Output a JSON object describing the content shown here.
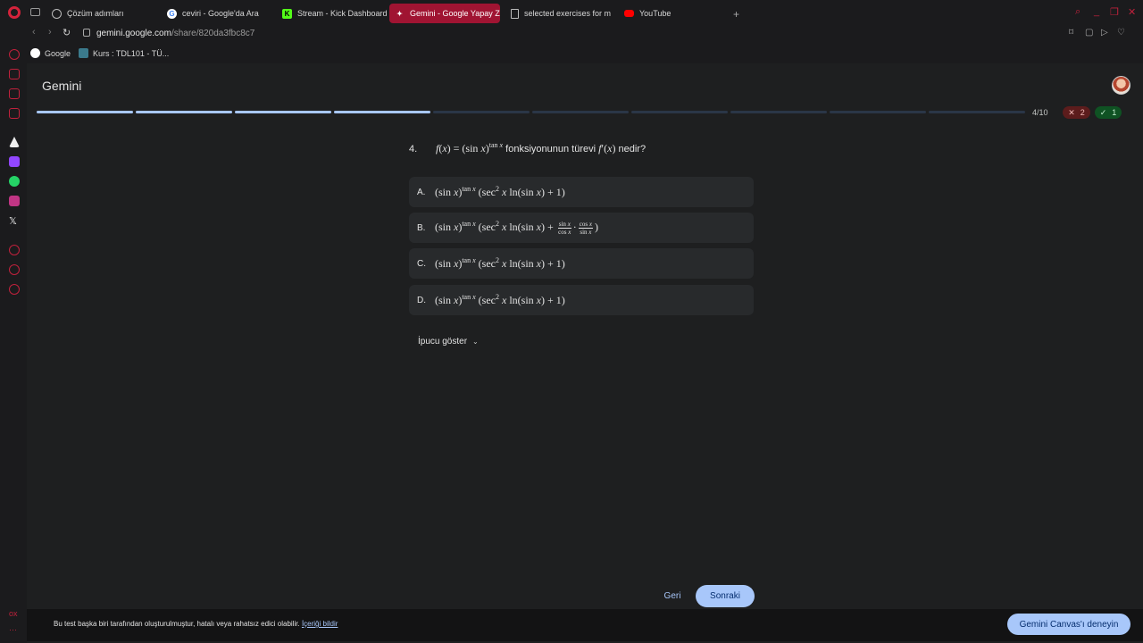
{
  "browser": {
    "tabs": [
      {
        "label": "Çözüm adımları",
        "active": false
      },
      {
        "label": "ceviri - Google'da Ara",
        "active": false
      },
      {
        "label": "Stream - Kick Dashboard",
        "active": false
      },
      {
        "label": "Gemini - Google Yapay Z",
        "active": true
      },
      {
        "label": "selected exercises for m",
        "active": false
      },
      {
        "label": "YouTube",
        "active": false
      }
    ],
    "url_host": "gemini.google.com",
    "url_path": "/share/820da3fbc8c7",
    "bookmarks": [
      {
        "label": "Google"
      },
      {
        "label": "Kurs : TDL101 - TÜ..."
      }
    ],
    "sidebar_bottom_text": "ox",
    "colors": {
      "accent": "#c0213c",
      "active_tab": "#a01432"
    }
  },
  "app": {
    "title": "Gemini"
  },
  "quiz": {
    "progress_total": 10,
    "progress_done": 4,
    "counter": "4/10",
    "wrong_count": "2",
    "right_count": "1",
    "question_number": "4.",
    "question_text": "fonksiyonunun türevi",
    "question_tail": "nedir?",
    "options": [
      {
        "letter": "A."
      },
      {
        "letter": "B."
      },
      {
        "letter": "C."
      },
      {
        "letter": "D."
      }
    ],
    "hint_label": "İpucu göster",
    "back_label": "Geri",
    "next_label": "Sonraki"
  },
  "footer": {
    "disclaimer": "Bu test başka biri tarafından oluşturulmuştur, hatalı veya rahatsız edici olabilir.",
    "report_link": "İçeriği bildir",
    "canvas_button": "Gemini Canvas'ı deneyin"
  }
}
